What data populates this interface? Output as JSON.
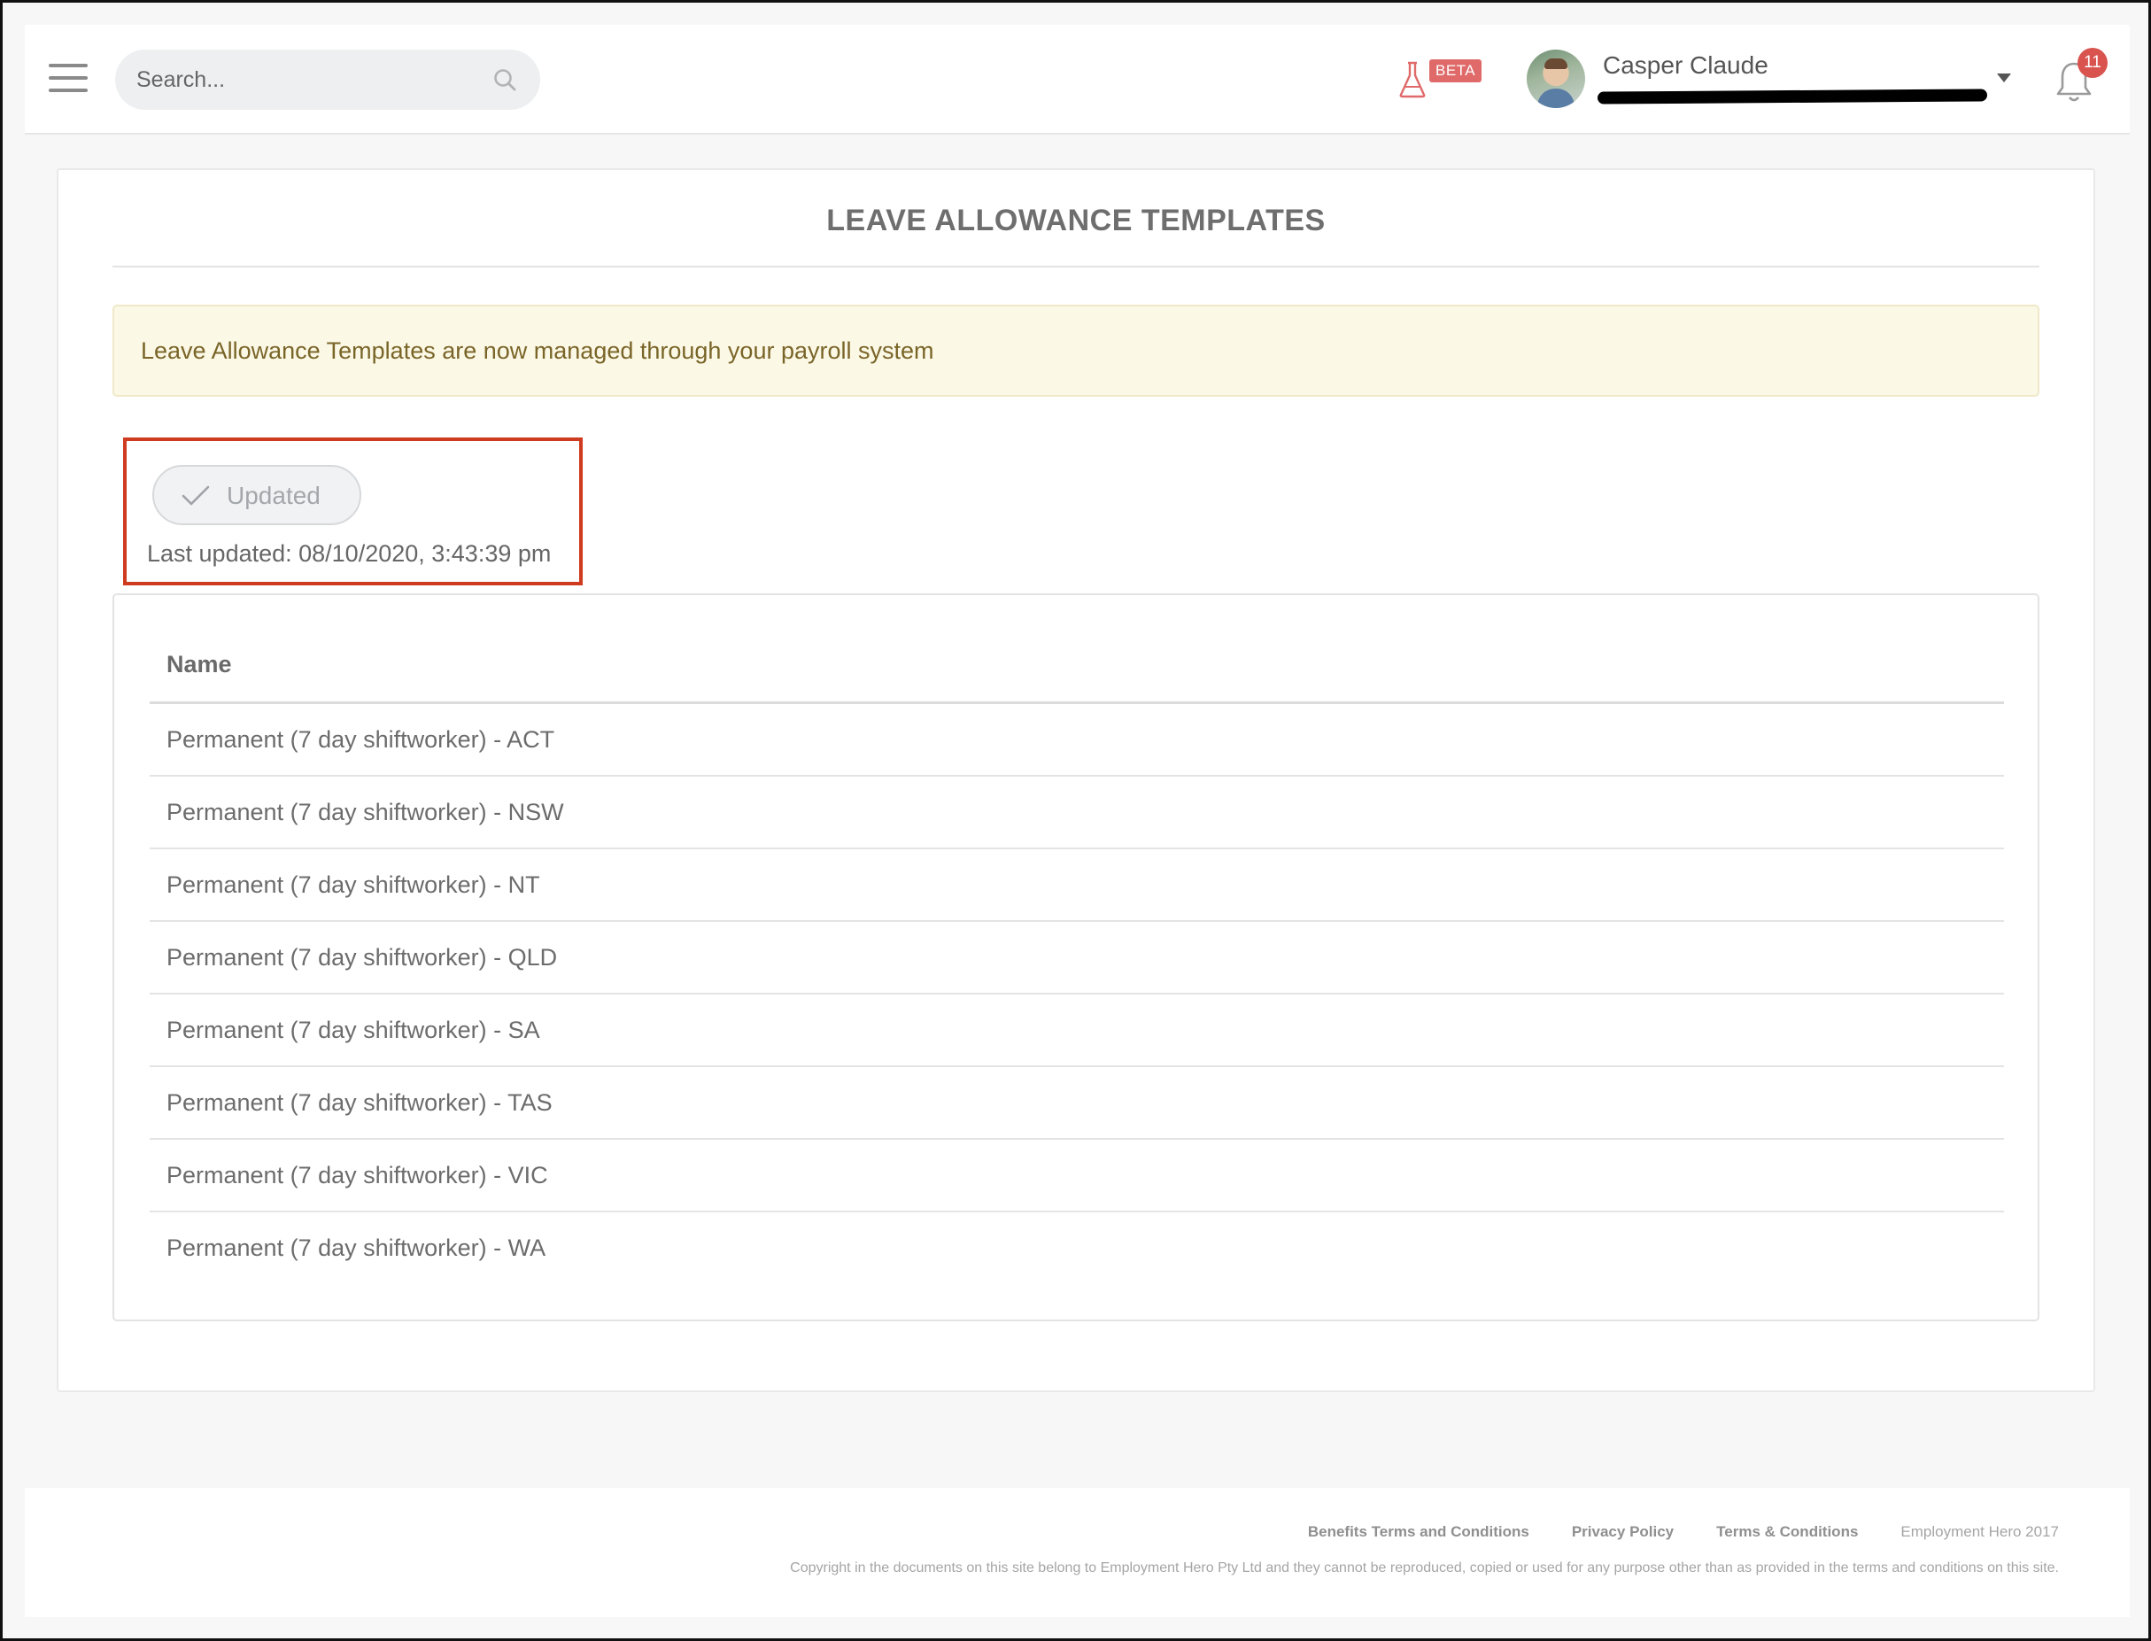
{
  "header": {
    "search_placeholder": "Search...",
    "beta_label": "BETA",
    "user_name": "Casper Claude",
    "notification_count": "11"
  },
  "page": {
    "title": "LEAVE ALLOWANCE TEMPLATES",
    "notice": "Leave Allowance Templates are now managed through your payroll system",
    "updated_button": "Updated",
    "last_updated": "Last updated: 08/10/2020, 3:43:39 pm"
  },
  "table": {
    "column_header": "Name",
    "rows": [
      "Permanent (7 day shiftworker) - ACT",
      "Permanent (7 day shiftworker) - NSW",
      "Permanent (7 day shiftworker) - NT",
      "Permanent (7 day shiftworker) - QLD",
      "Permanent (7 day shiftworker) - SA",
      "Permanent (7 day shiftworker) - TAS",
      "Permanent (7 day shiftworker) - VIC",
      "Permanent (7 day shiftworker) - WA"
    ]
  },
  "footer": {
    "links": [
      "Benefits Terms and Conditions",
      "Privacy Policy",
      "Terms & Conditions"
    ],
    "brand": "Employment Hero 2017",
    "copyright": "Copyright in the documents on this site belong to Employment Hero Pty Ltd and they cannot be reproduced, copied or used for any purpose other than as provided in the terms and conditions on this site."
  },
  "colors": {
    "accent_highlight": "#cf3b1f",
    "notice_bg": "#fbf8e6",
    "badge_red": "#d9534f",
    "beta_red": "#e06a6a"
  },
  "icons": [
    "menu-icon",
    "search-icon",
    "flask-icon",
    "chevron-down-icon",
    "bell-icon",
    "check-icon"
  ]
}
